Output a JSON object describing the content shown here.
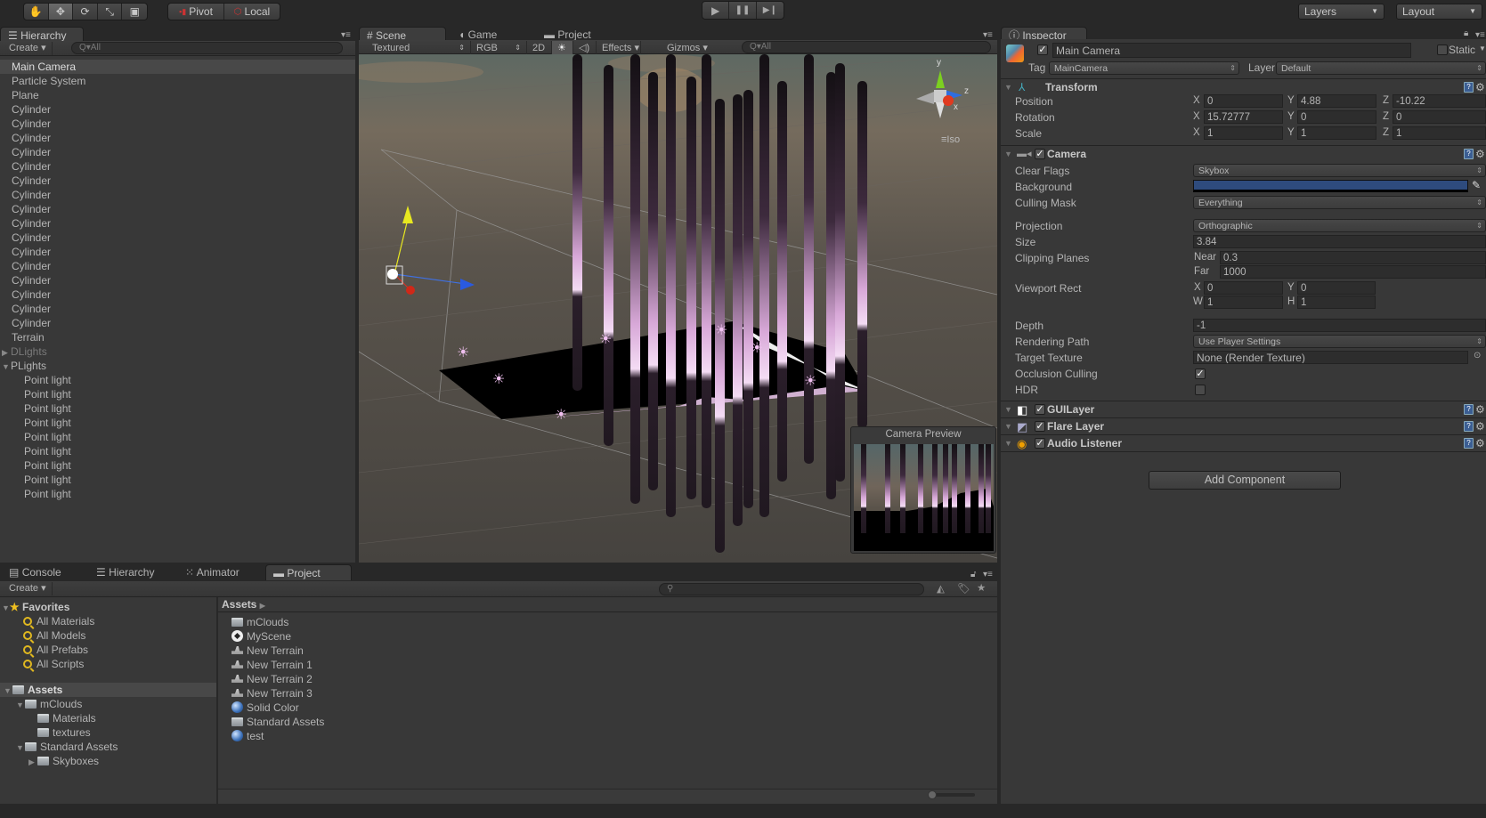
{
  "toolbar": {
    "tools": [
      {
        "name": "hand-tool",
        "glyph": "✋"
      },
      {
        "name": "move-tool",
        "glyph": "✥"
      },
      {
        "name": "rotate-tool",
        "glyph": "⟳"
      },
      {
        "name": "scale-tool",
        "glyph": "⤡"
      },
      {
        "name": "rect-tool",
        "glyph": "▣"
      }
    ],
    "active_tool": "move-tool",
    "pivot_label": "Pivot",
    "local_label": "Local",
    "play_glyph": "▶",
    "pause_glyph": "❚❚",
    "step_glyph": "▶❙",
    "layers_label": "Layers",
    "layout_label": "Layout"
  },
  "hierarchy": {
    "tab_label": "Hierarchy",
    "create_label": "Create",
    "search_placeholder": "Q▾All",
    "items": [
      {
        "label": "Main Camera",
        "selected": true
      },
      {
        "label": "Particle System"
      },
      {
        "label": "Plane"
      },
      {
        "label": "Cylinder"
      },
      {
        "label": "Cylinder"
      },
      {
        "label": "Cylinder"
      },
      {
        "label": "Cylinder"
      },
      {
        "label": "Cylinder"
      },
      {
        "label": "Cylinder"
      },
      {
        "label": "Cylinder"
      },
      {
        "label": "Cylinder"
      },
      {
        "label": "Cylinder"
      },
      {
        "label": "Cylinder"
      },
      {
        "label": "Cylinder"
      },
      {
        "label": "Cylinder"
      },
      {
        "label": "Cylinder"
      },
      {
        "label": "Cylinder"
      },
      {
        "label": "Cylinder"
      },
      {
        "label": "Cylinder"
      },
      {
        "label": "Terrain"
      },
      {
        "label": "DLights",
        "collapsed": true,
        "dim": true
      },
      {
        "label": "PLights",
        "expanded": true
      },
      {
        "label": "Point light",
        "child": true
      },
      {
        "label": "Point light",
        "child": true
      },
      {
        "label": "Point light",
        "child": true
      },
      {
        "label": "Point light",
        "child": true
      },
      {
        "label": "Point light",
        "child": true
      },
      {
        "label": "Point light",
        "child": true
      },
      {
        "label": "Point light",
        "child": true
      },
      {
        "label": "Point light",
        "child": true
      },
      {
        "label": "Point light",
        "child": true
      }
    ]
  },
  "scene": {
    "tabs": [
      {
        "label": "Scene",
        "icon": "#",
        "active": true
      },
      {
        "label": "Game",
        "icon": "◖"
      },
      {
        "label": "Project",
        "icon": "▬"
      }
    ],
    "draw_mode": "Textured",
    "render_mode": "RGB",
    "mode_2d": "2D",
    "lighting_glyph": "☀",
    "audio_glyph": "◁)",
    "effects_label": "Effects",
    "gizmos_label": "Gizmos",
    "search_placeholder": "Q▾All",
    "gizmo_axes": {
      "y": "y",
      "z": "z",
      "x": "x"
    },
    "projection_label": "Iso",
    "camera_preview_title": "Camera Preview"
  },
  "inspector": {
    "tab_label": "Inspector",
    "object_name": "Main Camera",
    "object_active": true,
    "static_label": "Static",
    "static_checked": false,
    "tag_label": "Tag",
    "tag_value": "MainCamera",
    "layer_label": "Layer",
    "layer_value": "Default",
    "transform": {
      "title": "Transform",
      "position": {
        "label": "Position",
        "x": "0",
        "y": "4.88",
        "z": "-10.22"
      },
      "rotation": {
        "label": "Rotation",
        "x": "15.72777",
        "y": "0",
        "z": "0"
      },
      "scale": {
        "label": "Scale",
        "x": "1",
        "y": "1",
        "z": "1"
      }
    },
    "camera": {
      "title": "Camera",
      "enabled": true,
      "clear_flags_label": "Clear Flags",
      "clear_flags": "Skybox",
      "background_label": "Background",
      "background_color": "#2e4b7d",
      "culling_mask_label": "Culling Mask",
      "culling_mask": "Everything",
      "projection_label": "Projection",
      "projection": "Orthographic",
      "size_label": "Size",
      "size": "3.84",
      "clipping_label": "Clipping Planes",
      "near_label": "Near",
      "near": "0.3",
      "far_label": "Far",
      "far": "1000",
      "viewport_label": "Viewport Rect",
      "vx": "0",
      "vy": "0",
      "vw": "1",
      "vh": "1",
      "depth_label": "Depth",
      "depth": "-1",
      "rendering_path_label": "Rendering Path",
      "rendering_path": "Use Player Settings",
      "target_texture_label": "Target Texture",
      "target_texture": "None (Render Texture)",
      "occlusion_label": "Occlusion Culling",
      "occlusion": true,
      "hdr_label": "HDR",
      "hdr": false
    },
    "components": [
      {
        "title": "GUILayer",
        "enabled": true
      },
      {
        "title": "Flare Layer",
        "enabled": true
      },
      {
        "title": "Audio Listener",
        "enabled": true
      }
    ],
    "add_component_label": "Add Component"
  },
  "bottom": {
    "tabs": [
      {
        "label": "Console",
        "icon": "▤"
      },
      {
        "label": "Hierarchy",
        "icon": "☰"
      },
      {
        "label": "Animator",
        "icon": "⁙"
      },
      {
        "label": "Project",
        "icon": "▬",
        "active": true
      }
    ],
    "create_label": "Create",
    "favorites": {
      "title": "Favorites",
      "items": [
        "All Materials",
        "All Models",
        "All Prefabs",
        "All Scripts"
      ]
    },
    "tree": [
      {
        "label": "Assets",
        "level": 0,
        "expanded": true,
        "selected": true
      },
      {
        "label": "mClouds",
        "level": 1,
        "expanded": true
      },
      {
        "label": "Materials",
        "level": 2
      },
      {
        "label": "textures",
        "level": 2
      },
      {
        "label": "Standard Assets",
        "level": 1,
        "expanded": true
      },
      {
        "label": "Skyboxes",
        "level": 2,
        "collapsed": true
      }
    ],
    "breadcrumb": "Assets",
    "assets": [
      {
        "label": "mClouds",
        "type": "folder"
      },
      {
        "label": "MyScene",
        "type": "scene"
      },
      {
        "label": "New Terrain",
        "type": "terrain"
      },
      {
        "label": "New Terrain 1",
        "type": "terrain"
      },
      {
        "label": "New Terrain 2",
        "type": "terrain"
      },
      {
        "label": "New Terrain 3",
        "type": "terrain"
      },
      {
        "label": "Solid Color",
        "type": "material"
      },
      {
        "label": "Standard Assets",
        "type": "folder"
      },
      {
        "label": "test",
        "type": "material"
      }
    ],
    "icon_size_slider": 0
  }
}
